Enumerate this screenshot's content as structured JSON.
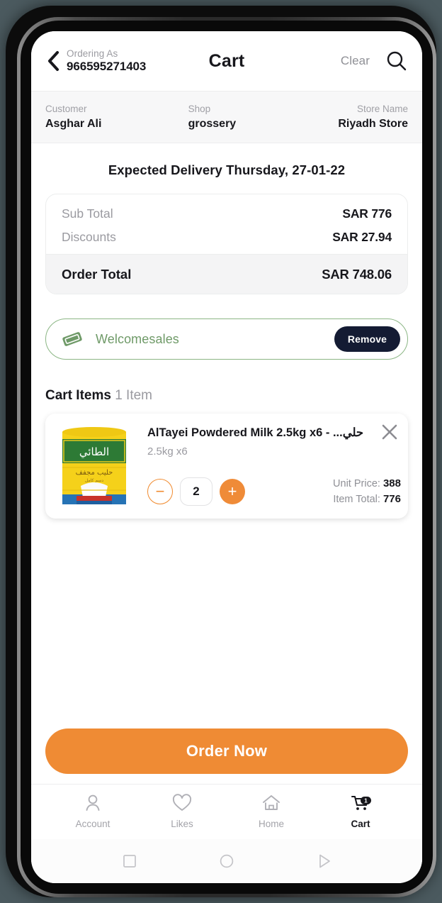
{
  "header": {
    "back_icon": "chevron-left-icon",
    "ordering_as_label": "Ordering As",
    "ordering_as_value": "966595271403",
    "title": "Cart",
    "clear_label": "Clear",
    "search_icon": "search-icon"
  },
  "info_strip": [
    {
      "label": "Customer",
      "value": "Asghar Ali"
    },
    {
      "label": "Shop",
      "value": "grossery"
    },
    {
      "label": "Store Name",
      "value": "Riyadh Store"
    }
  ],
  "delivery": {
    "text": "Expected Delivery Thursday, 27-01-22"
  },
  "totals": {
    "sub_total_label": "Sub Total",
    "sub_total_value": "SAR 776",
    "discounts_label": "Discounts",
    "discounts_value": "SAR 27.94",
    "order_total_label": "Order Total",
    "order_total_value": "SAR 748.06"
  },
  "promo": {
    "icon": "ticket-icon",
    "code": "Welcomesales",
    "remove_label": "Remove"
  },
  "cart_items_section": {
    "heading": "Cart Items",
    "count": "1 Item"
  },
  "item": {
    "image_alt": "altayei-powdered-milk-tin",
    "title": "AlTayei Powdered Milk  2.5kg x6 -  ...حلي",
    "subtitle": "2.5kg x6",
    "close_icon": "close-icon",
    "decrement_label": "−",
    "quantity": "2",
    "increment_label": "+",
    "unit_price_label": "Unit Price:",
    "unit_price_value": "388",
    "item_total_label": "Item Total:",
    "item_total_value": "776"
  },
  "order_button": {
    "label": "Order Now"
  },
  "bottom_nav": [
    {
      "label": "Account",
      "icon": "person-icon",
      "active": false
    },
    {
      "label": "Likes",
      "icon": "heart-icon",
      "active": false
    },
    {
      "label": "Home",
      "icon": "home-icon",
      "active": false
    },
    {
      "label": "Cart",
      "icon": "cart-icon",
      "active": true,
      "badge": "1"
    }
  ],
  "android_nav": {
    "recents_icon": "square-icon",
    "home_icon": "circle-icon",
    "back_icon": "triangle-icon"
  },
  "colors": {
    "accent_orange": "#ef8b34",
    "promo_green": "#6f9a68",
    "remove_navy": "#141b33",
    "text_dark": "#17171c",
    "text_muted": "#9a9aa0"
  }
}
